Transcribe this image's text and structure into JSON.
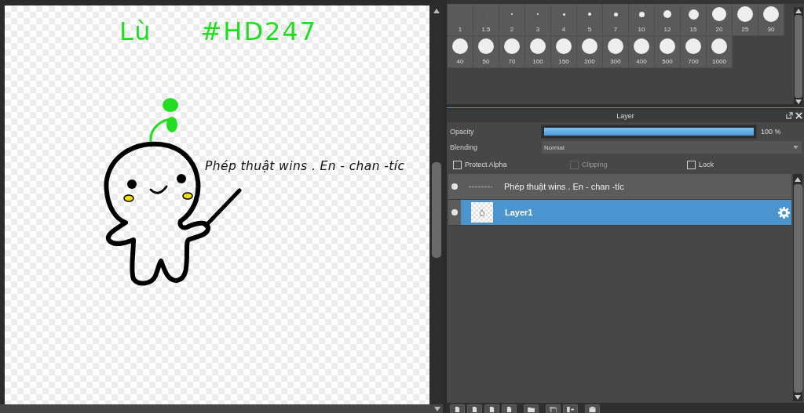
{
  "canvas": {
    "handwritten_texts": [
      "Lù",
      "#HD247"
    ],
    "text_layer": "Phép thuật wins . En - chan -tíc"
  },
  "brush_size_panel": {
    "sizes": [
      "1",
      "1.5",
      "2",
      "3",
      "4",
      "5",
      "7",
      "10",
      "12",
      "15",
      "20",
      "25",
      "30",
      "40",
      "50",
      "70",
      "100",
      "150",
      "200",
      "300",
      "400",
      "500",
      "700",
      "1000"
    ]
  },
  "layer_panel": {
    "title": "Layer",
    "opacity": {
      "label": "Opacity",
      "level": 1,
      "reading": "100 %"
    },
    "blending": {
      "label": "Blending",
      "value": "Normal"
    },
    "options": [
      {
        "label": "Protect Alpha",
        "checked": false,
        "disabled": false
      },
      {
        "label": "Clipping",
        "checked": false,
        "disabled": true
      },
      {
        "label": "Lock",
        "checked": false,
        "disabled": false
      }
    ],
    "layers": [
      {
        "name": "Phép thuật wins . En - chan -tíc",
        "kind": "text",
        "visible": true,
        "selected": false
      },
      {
        "name": "Layer1",
        "kind": "raster",
        "visible": true,
        "selected": true
      }
    ]
  }
}
